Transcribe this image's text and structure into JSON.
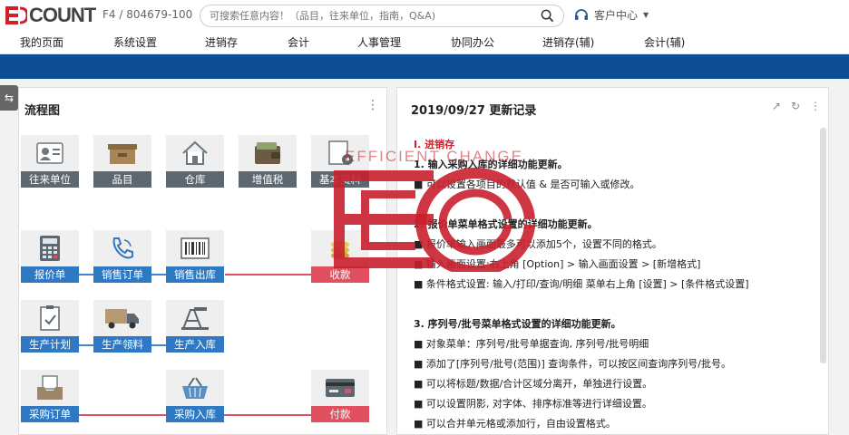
{
  "header": {
    "logo_text": "ECOUNT",
    "company_code": "F4 / 804679-100",
    "search_placeholder": "可搜索任意内容！（品目，往来单位，指南，Q&A)",
    "support_label": "客户中心"
  },
  "menu": [
    "我的页面",
    "系统设置",
    "进销存",
    "会计",
    "人事管理",
    "协同办公",
    "进销存(辅)",
    "会计(辅)"
  ],
  "flow": {
    "title": "流程图",
    "nodes": [
      {
        "label": "往来单位",
        "color": "gray",
        "icon": "contact-card-icon"
      },
      {
        "label": "品目",
        "color": "gray",
        "icon": "box-icon"
      },
      {
        "label": "仓库",
        "color": "gray",
        "icon": "house-icon"
      },
      {
        "label": "增值税",
        "color": "gray",
        "icon": "wallet-icon"
      },
      {
        "label": "基本资料",
        "color": "gray",
        "icon": "document-gear-icon"
      },
      {
        "label": "报价单",
        "color": "blue",
        "icon": "calculator-icon"
      },
      {
        "label": "销售订单",
        "color": "blue",
        "icon": "phone-icon"
      },
      {
        "label": "销售出库",
        "color": "blue",
        "icon": "barcode-icon"
      },
      {
        "label": "收款",
        "color": "red",
        "icon": "coins-icon"
      },
      {
        "label": "生产计划",
        "color": "blue",
        "icon": "checklist-icon"
      },
      {
        "label": "生产领料",
        "color": "blue",
        "icon": "truck-icon"
      },
      {
        "label": "生产入库",
        "color": "blue",
        "icon": "factory-icon"
      },
      {
        "label": "采购订单",
        "color": "blue",
        "icon": "inbox-icon"
      },
      {
        "label": "采购入库",
        "color": "blue",
        "icon": "basket-icon"
      },
      {
        "label": "付款",
        "color": "red",
        "icon": "credit-card-icon"
      }
    ]
  },
  "update": {
    "title": "2019/09/27 更新记录",
    "section": "Ⅰ. 进销存",
    "items": [
      {
        "type": "h",
        "text": "1. 输入采购入库的详细功能更新。"
      },
      {
        "type": "t",
        "text": "■ 可以设置各项目的默认值 & 是否可输入或修改。"
      },
      {
        "type": "gap",
        "text": ""
      },
      {
        "type": "h",
        "text": "2. 报价单菜单格式设置的详细功能更新。"
      },
      {
        "type": "t",
        "text": "■ 报价单输入画面最多可以添加5个，设置不同的格式。"
      },
      {
        "type": "t",
        "text": "■ 输入画面设置:右上角 [Option] > 输入画面设置 > [新增格式]"
      },
      {
        "type": "t",
        "text": "■ 条件格式设置: 输入/打印/查询/明细 菜单右上角 [设置] > [条件格式设置]"
      },
      {
        "type": "gap",
        "text": ""
      },
      {
        "type": "h",
        "text": "3. 序列号/批号菜单格式设置的详细功能更新。"
      },
      {
        "type": "t",
        "text": "■ 对象菜单：序列号/批号单据查询, 序列号/批号明细"
      },
      {
        "type": "t",
        "text": "■ 添加了[序列号/批号(范围)] 查询条件，可以按区间查询序列号/批号。"
      },
      {
        "type": "t",
        "text": "■ 可以将标题/数据/合计区域分离开，单独进行设置。"
      },
      {
        "type": "t",
        "text": "■ 可以设置阴影, 对字体、排序标准等进行详细设置。"
      },
      {
        "type": "t",
        "text": "■ 可以合并单元格或添加行，自由设置格式。"
      }
    ]
  },
  "watermark": {
    "text": "EFFICIENT CHANGE",
    "color": "#c8202e"
  }
}
